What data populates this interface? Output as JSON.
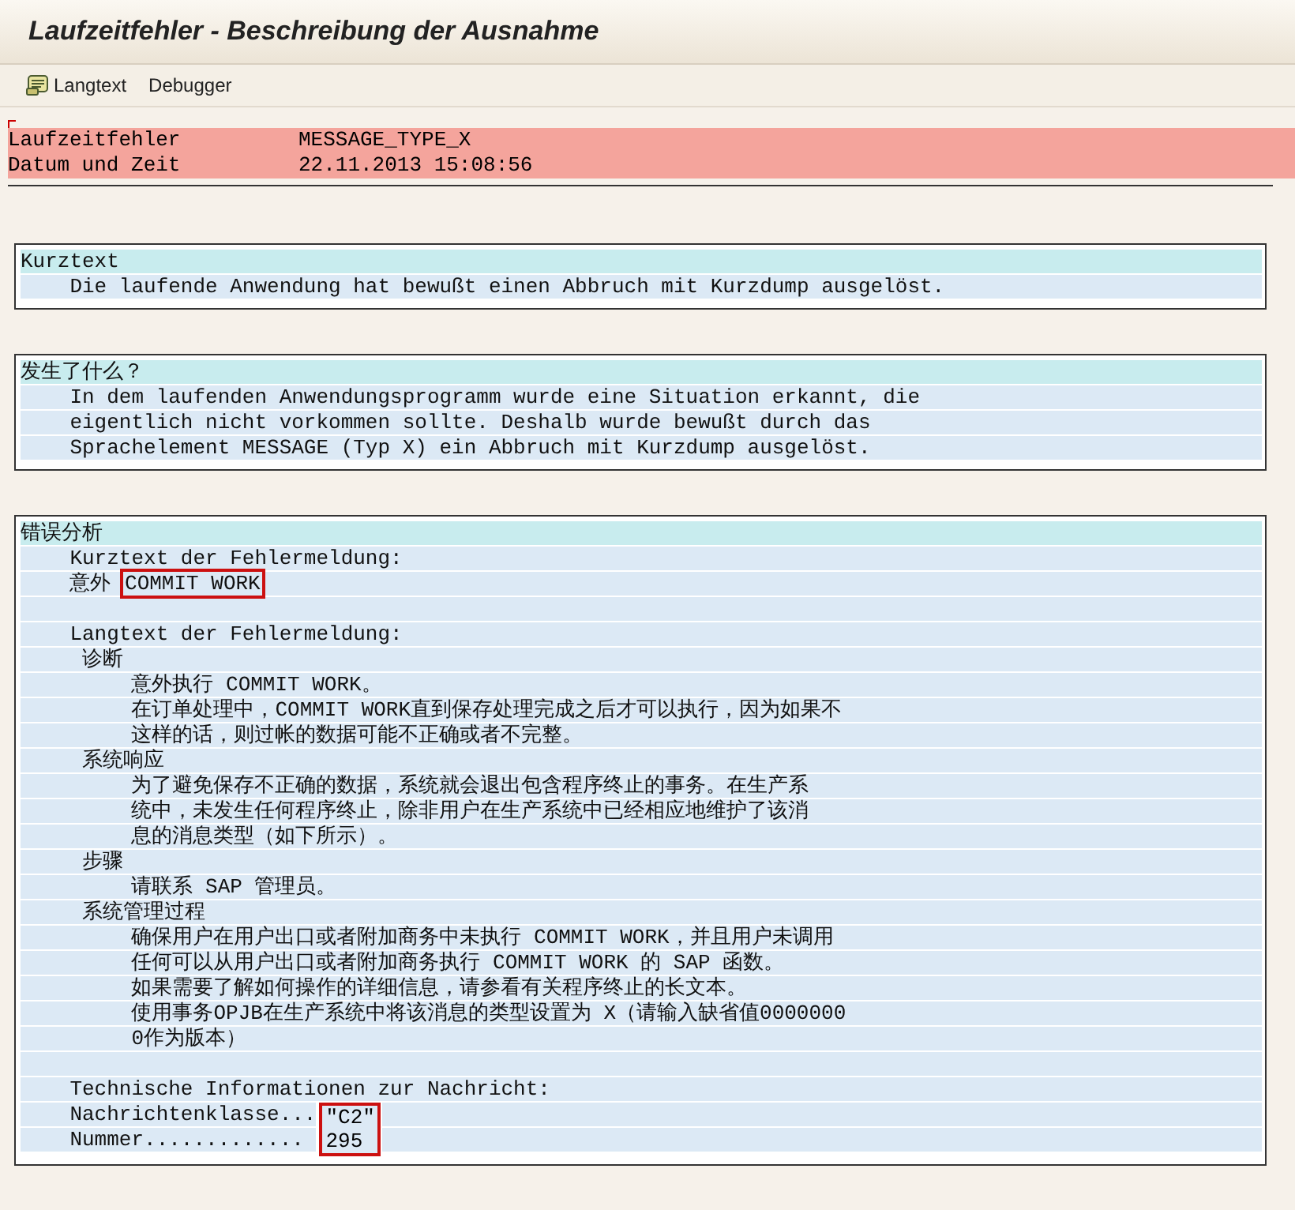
{
  "window": {
    "title": "Laufzeitfehler - Beschreibung der Ausnahme"
  },
  "toolbar": [
    {
      "kind": "icon-button",
      "label": "Langtext"
    },
    {
      "kind": "text-button",
      "label": "Debugger"
    }
  ],
  "header_rows": [
    {
      "label": "Laufzeitfehler",
      "value": "MESSAGE_TYPE_X"
    },
    {
      "label": "Datum und Zeit",
      "value": "22.11.2013 15:08:56"
    }
  ],
  "sections": [
    {
      "title": "Kurztext",
      "lines": [
        {
          "kind": "text",
          "text": "    Die laufende Anwendung hat bewußt einen Abbruch mit Kurzdump ausgelöst."
        }
      ]
    },
    {
      "title": "发生了什么？",
      "lines": [
        {
          "kind": "text",
          "text": "    In dem laufenden Anwendungsprogramm wurde eine Situation erkannt, die"
        },
        {
          "kind": "text",
          "text": "    eigentlich nicht vorkommen sollte. Deshalb wurde bewußt durch das"
        },
        {
          "kind": "text",
          "text": "    Sprachelement MESSAGE (Typ X) ein Abbruch mit Kurzdump ausgelöst."
        }
      ]
    },
    {
      "title": "错误分析",
      "lines": [
        {
          "kind": "text",
          "text": "    Kurztext der Fehlermeldung:"
        },
        {
          "kind": "boxed",
          "text": "    意外",
          "boxed": "COMMIT WORK"
        },
        {
          "kind": "blank"
        },
        {
          "kind": "text",
          "text": "    Langtext der Fehlermeldung:"
        },
        {
          "kind": "text",
          "text": "     诊断"
        },
        {
          "kind": "text",
          "text": "         意外执行 COMMIT WORK。"
        },
        {
          "kind": "text",
          "text": "         在订单处理中，COMMIT WORK直到保存处理完成之后才可以执行，因为如果不"
        },
        {
          "kind": "text",
          "text": "         这样的话，则过帐的数据可能不正确或者不完整。"
        },
        {
          "kind": "text",
          "text": "     系统响应"
        },
        {
          "kind": "text",
          "text": "         为了避免保存不正确的数据，系统就会退出包含程序终止的事务。在生产系"
        },
        {
          "kind": "text",
          "text": "         统中，未发生任何程序终止，除非用户在生产系统中已经相应地维护了该消"
        },
        {
          "kind": "text",
          "text": "         息的消息类型（如下所示）。"
        },
        {
          "kind": "text",
          "text": "     步骤"
        },
        {
          "kind": "text",
          "text": "         请联系 SAP 管理员。"
        },
        {
          "kind": "text",
          "text": "     系统管理过程"
        },
        {
          "kind": "text",
          "text": "         确保用户在用户出口或者附加商务中未执行 COMMIT WORK，并且用户未调用"
        },
        {
          "kind": "text",
          "text": "         任何可以从用户出口或者附加商务执行 COMMIT WORK 的 SAP 函数。"
        },
        {
          "kind": "text",
          "text": "         如果需要了解如何操作的详细信息，请参看有关程序终止的长文本。"
        },
        {
          "kind": "text",
          "text": "         使用事务OPJB在生产系统中将该消息的类型设置为 X（请输入缺省值0000000"
        },
        {
          "kind": "text",
          "text": "         0作为版本）"
        },
        {
          "kind": "blank"
        },
        {
          "kind": "text",
          "text": "    Technische Informationen zur Nachricht:"
        },
        {
          "kind": "fields",
          "rows": [
            {
              "label": "    Nachrichtenklasse...",
              "value": "\"C2\""
            },
            {
              "label": "    Nummer.............",
              "value": "295"
            }
          ]
        }
      ]
    }
  ]
}
